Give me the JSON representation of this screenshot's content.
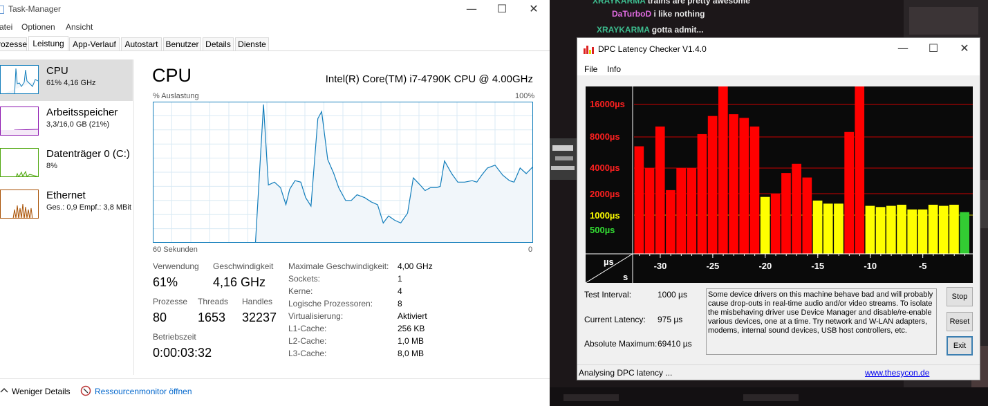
{
  "task_manager": {
    "title": "Task-Manager",
    "menu": [
      "atei",
      "Optionen",
      "Ansicht"
    ],
    "tabs": [
      "rozesse",
      "Leistung",
      "App-Verlauf",
      "Autostart",
      "Benutzer",
      "Details",
      "Dienste"
    ],
    "active_tab": "Leistung",
    "sidebar": [
      {
        "name": "CPU",
        "sub": "61% 4,16 GHz",
        "color": "#117dbb"
      },
      {
        "name": "Arbeitsspeicher",
        "sub": "3,3/16,0 GB (21%)",
        "color": "#8b12ae"
      },
      {
        "name": "Datenträger 0 (C:)",
        "sub": "8%",
        "color": "#4da60c"
      },
      {
        "name": "Ethernet",
        "sub": "Ges.: 0,9  Empf.: 3,8 MBit",
        "color": "#a74f01"
      }
    ],
    "cpu": {
      "title": "CPU",
      "model": "Intel(R) Core(TM) i7-4790K CPU @ 4.00GHz",
      "graph_label_top_left": "% Auslastung",
      "graph_label_top_right": "100%",
      "graph_label_bottom_left": "60 Sekunden",
      "graph_label_bottom_right": "0",
      "usage_history_percent": [
        0,
        0,
        0,
        0,
        0,
        0,
        0,
        0,
        0,
        0,
        0,
        0,
        0,
        0,
        0,
        0,
        0,
        0,
        0,
        0,
        0,
        0,
        0,
        0,
        0,
        0,
        0,
        0,
        0,
        0,
        0,
        0,
        0,
        0,
        0,
        0,
        0,
        0,
        0,
        0,
        0,
        0,
        0,
        0,
        0,
        0,
        0,
        0,
        0,
        0,
        0,
        0,
        0,
        0,
        0,
        0,
        0,
        0,
        0,
        0,
        0,
        0,
        0,
        0,
        0,
        0,
        0,
        0,
        0,
        0,
        0,
        0,
        0,
        0,
        0,
        0,
        0,
        0,
        0,
        0,
        0,
        0,
        0,
        0,
        0,
        0,
        0,
        0,
        0,
        0,
        0,
        0,
        0,
        0,
        0,
        0,
        0,
        0,
        0,
        0,
        0,
        0,
        0,
        0,
        0,
        0,
        0,
        0,
        0,
        0,
        0,
        0,
        0,
        0,
        0,
        0,
        0,
        0,
        0,
        0,
        0,
        0,
        0,
        0,
        0,
        0,
        0,
        0,
        0,
        0,
        0,
        0,
        0,
        0,
        0,
        0,
        0,
        0,
        0,
        0,
        0,
        0,
        0,
        0,
        0,
        0,
        0,
        0,
        0,
        0,
        0,
        0,
        0,
        0,
        0,
        0,
        0,
        0,
        0,
        0,
        0,
        0,
        0,
        0,
        0,
        0,
        0,
        0,
        0,
        0,
        0,
        0,
        0,
        0,
        0,
        0,
        0,
        0,
        0,
        0,
        0,
        0,
        0,
        0,
        0,
        0,
        0,
        0,
        0,
        0,
        0,
        0,
        0,
        0,
        0,
        0,
        0,
        0,
        0,
        0,
        0,
        0,
        0,
        0,
        0,
        0,
        0,
        0,
        0,
        0,
        0,
        0,
        0,
        0,
        0,
        0,
        0,
        0,
        0,
        0,
        0,
        0,
        0,
        0,
        0,
        0,
        0,
        0
      ],
      "usage_curve": [
        [
          0,
          0
        ],
        [
          27.0,
          0
        ],
        [
          29.1,
          98
        ],
        [
          30.4,
          41
        ],
        [
          32.0,
          43
        ],
        [
          33.6,
          39
        ],
        [
          35.0,
          27
        ],
        [
          36.0,
          38
        ],
        [
          37.4,
          44
        ],
        [
          38.9,
          43
        ],
        [
          40.2,
          32
        ],
        [
          41.6,
          26
        ],
        [
          43.4,
          88
        ],
        [
          44.4,
          93
        ],
        [
          46.0,
          59
        ],
        [
          47.6,
          49
        ],
        [
          48.9,
          39
        ],
        [
          50.7,
          30
        ],
        [
          52.2,
          30
        ],
        [
          53.7,
          34
        ],
        [
          55.7,
          32
        ],
        [
          57.4,
          29
        ],
        [
          59.1,
          27
        ],
        [
          60.6,
          14
        ],
        [
          62.0,
          19
        ],
        [
          63.6,
          16
        ],
        [
          65.2,
          14
        ],
        [
          67.0,
          21
        ],
        [
          68.5,
          46
        ],
        [
          70.3,
          41
        ],
        [
          71.6,
          37
        ],
        [
          73.0,
          39
        ],
        [
          74.6,
          39
        ],
        [
          75.6,
          40
        ],
        [
          76.7,
          58
        ],
        [
          78.6,
          49
        ],
        [
          80.2,
          43
        ],
        [
          82.0,
          43
        ],
        [
          84.0,
          44
        ],
        [
          85.2,
          43
        ],
        [
          86.5,
          48
        ],
        [
          88.0,
          53
        ],
        [
          90.0,
          55
        ],
        [
          92.0,
          48
        ],
        [
          93.8,
          44
        ],
        [
          95.0,
          43
        ],
        [
          96.6,
          53
        ],
        [
          98.2,
          49
        ],
        [
          100,
          54
        ]
      ],
      "stats": {
        "usage_label": "Verwendung",
        "usage_value": "61%",
        "speed_label": "Geschwindigkeit",
        "speed_value": "4,16 GHz",
        "processes_label": "Prozesse",
        "processes_value": "80",
        "threads_label": "Threads",
        "threads_value": "1653",
        "handles_label": "Handles",
        "handles_value": "32237",
        "uptime_label": "Betriebszeit",
        "uptime_value": "0:00:03:32"
      },
      "details": [
        {
          "label": "Maximale Geschwindigkeit:",
          "value": "4,00 GHz"
        },
        {
          "label": "Sockets:",
          "value": "1"
        },
        {
          "label": "Kerne:",
          "value": "4"
        },
        {
          "label": "Logische Prozessoren:",
          "value": "8"
        },
        {
          "label": "Virtualisierung:",
          "value": "Aktiviert"
        },
        {
          "label": "L1-Cache:",
          "value": "256 KB"
        },
        {
          "label": "L2-Cache:",
          "value": "1,0 MB"
        },
        {
          "label": "L3-Cache:",
          "value": "8,0 MB"
        }
      ]
    },
    "footer": {
      "less_details": "Weniger Details",
      "resource_monitor": "Ressourcenmonitor öffnen"
    }
  },
  "chat": [
    {
      "user": "XRAYKARMA",
      "message": "trains are pretty awesome",
      "color": "#3dbd8f"
    },
    {
      "user": "DaTurboD",
      "message": "i like nothing",
      "color": "#e06be0"
    },
    {
      "user": "XRAYKARMA",
      "message": "gotta admit...",
      "color": "#3dbd8f"
    }
  ],
  "dpc": {
    "title": "DPC Latency Checker V1.4.0",
    "menu": [
      "File",
      "Info"
    ],
    "y_labels": [
      "16000µs",
      "8000µs",
      "4000µs",
      "2000µs",
      "1000µs",
      "500µs"
    ],
    "unit_top": "µs",
    "unit_bottom": "s",
    "x_ticks": [
      "-30",
      "-25",
      "-20",
      "-15",
      "-10",
      "-5"
    ],
    "chart_data": {
      "type": "bar",
      "xlabel": "s",
      "ylabel": "µs",
      "scale": "log",
      "x": [
        -32,
        -31,
        -30,
        -29,
        -28,
        -27,
        -26,
        -25,
        -24,
        -23,
        -22,
        -21,
        -20,
        -19,
        -18,
        -17,
        -16,
        -15,
        -14,
        -13,
        -12,
        -11,
        -10,
        -9,
        -8,
        -7,
        -6,
        -5,
        -4,
        -3,
        -2,
        -1
      ],
      "values": [
        6500,
        4000,
        10000,
        2200,
        4000,
        4000,
        8500,
        12500,
        69410,
        13000,
        12000,
        10000,
        1800,
        2000,
        3500,
        4400,
        3100,
        1600,
        1450,
        1450,
        8900,
        69410,
        1350,
        1300,
        1350,
        1400,
        1200,
        1200,
        1400,
        1350,
        1400,
        1100
      ],
      "colors": [
        "#ff0000",
        "#ff0000",
        "#ff0000",
        "#ff0000",
        "#ff0000",
        "#ff0000",
        "#ff0000",
        "#ff0000",
        "#ff0000",
        "#ff0000",
        "#ff0000",
        "#ff0000",
        "#ffff00",
        "#ff0000",
        "#ff0000",
        "#ff0000",
        "#ff0000",
        "#ffff00",
        "#ffff00",
        "#ffff00",
        "#ff0000",
        "#ff0000",
        "#ffff00",
        "#ffff00",
        "#ffff00",
        "#ffff00",
        "#ffff00",
        "#ffff00",
        "#ffff00",
        "#ffff00",
        "#ffff00",
        "#33cc33"
      ]
    },
    "test_interval_label": "Test Interval:",
    "test_interval_value": "1000 µs",
    "current_latency_label": "Current Latency:",
    "current_latency_value": "975 µs",
    "absolute_max_label": "Absolute Maximum:",
    "absolute_max_value": "69410 µs",
    "message": "Some device drivers on this machine behave bad and will probably cause drop-outs in real-time audio and/or video streams. To isolate the misbehaving driver use Device Manager and disable/re-enable various devices, one at a time. Try network and W-LAN adapters, modems, internal sound devices, USB host controllers, etc.",
    "buttons": {
      "stop": "Stop",
      "reset": "Reset",
      "exit": "Exit"
    },
    "status": "Analysing DPC latency ...",
    "link": "www.thesycon.de"
  }
}
